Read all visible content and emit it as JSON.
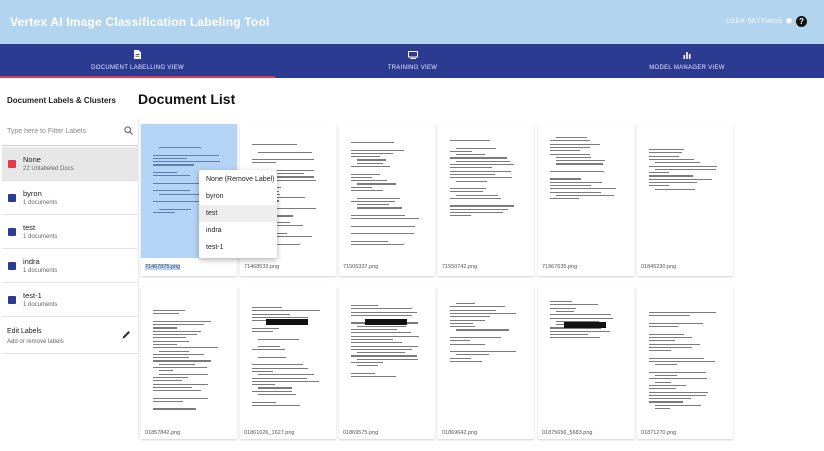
{
  "app": {
    "title": "Vertex AI Image Classification Labeling Tool",
    "user_settings_label": "USER SETTINGS",
    "help_label": "?"
  },
  "nav": {
    "tabs": [
      {
        "label": "DOCUMENT LABELLING VIEW",
        "icon": "document-icon",
        "active": true
      },
      {
        "label": "TRAINING VIEW",
        "icon": "monitor-icon",
        "active": false
      },
      {
        "label": "MODEL MANAGER VIEW",
        "icon": "bar-chart-icon",
        "active": false
      }
    ]
  },
  "sidebar": {
    "heading": "Document Labels & Clusters",
    "filter_placeholder": "Type here to Filter Labels",
    "labels": [
      {
        "name": "None",
        "count": "22 Unlabeled Docs",
        "color": "#e33b4b",
        "selected": true
      },
      {
        "name": "byron",
        "count": "1 documents",
        "color": "#2c3b92",
        "selected": false
      },
      {
        "name": "test",
        "count": "1 documents",
        "color": "#2c3b92",
        "selected": false
      },
      {
        "name": "indra",
        "count": "1 documents",
        "color": "#2c3b92",
        "selected": false
      },
      {
        "name": "test-1",
        "count": "1 documents",
        "color": "#2c3b92",
        "selected": false
      }
    ],
    "edit": {
      "title": "Edit Labels",
      "subtitle": "Add or remove labels"
    }
  },
  "main": {
    "title": "Document List",
    "documents": [
      {
        "filename": "71467875.png",
        "selected": true
      },
      {
        "filename": "71468533.png",
        "selected": false
      },
      {
        "filename": "71506337.png",
        "selected": false
      },
      {
        "filename": "71550742.png",
        "selected": false
      },
      {
        "filename": "71967635.png",
        "selected": false
      },
      {
        "filename": "01845230.png",
        "selected": false
      },
      {
        "filename": "01857842.png",
        "selected": false
      },
      {
        "filename": "01861626_1627.png",
        "selected": false
      },
      {
        "filename": "01869575.png",
        "selected": false
      },
      {
        "filename": "01869642.png",
        "selected": false
      },
      {
        "filename": "01875656_5683.png",
        "selected": false
      },
      {
        "filename": "01871270.png",
        "selected": false
      }
    ]
  },
  "context_menu": {
    "items": [
      {
        "label": "None (Remove Label)",
        "hover": false
      },
      {
        "label": "byron",
        "hover": false
      },
      {
        "label": "test",
        "hover": true
      },
      {
        "label": "indra",
        "hover": false
      },
      {
        "label": "test-1",
        "hover": false
      }
    ]
  },
  "colors": {
    "topbar": "#b3d4ee",
    "navbar": "#2c3b92",
    "accent_red": "#e33b4b",
    "selection_blue": "#b5d3f5"
  }
}
